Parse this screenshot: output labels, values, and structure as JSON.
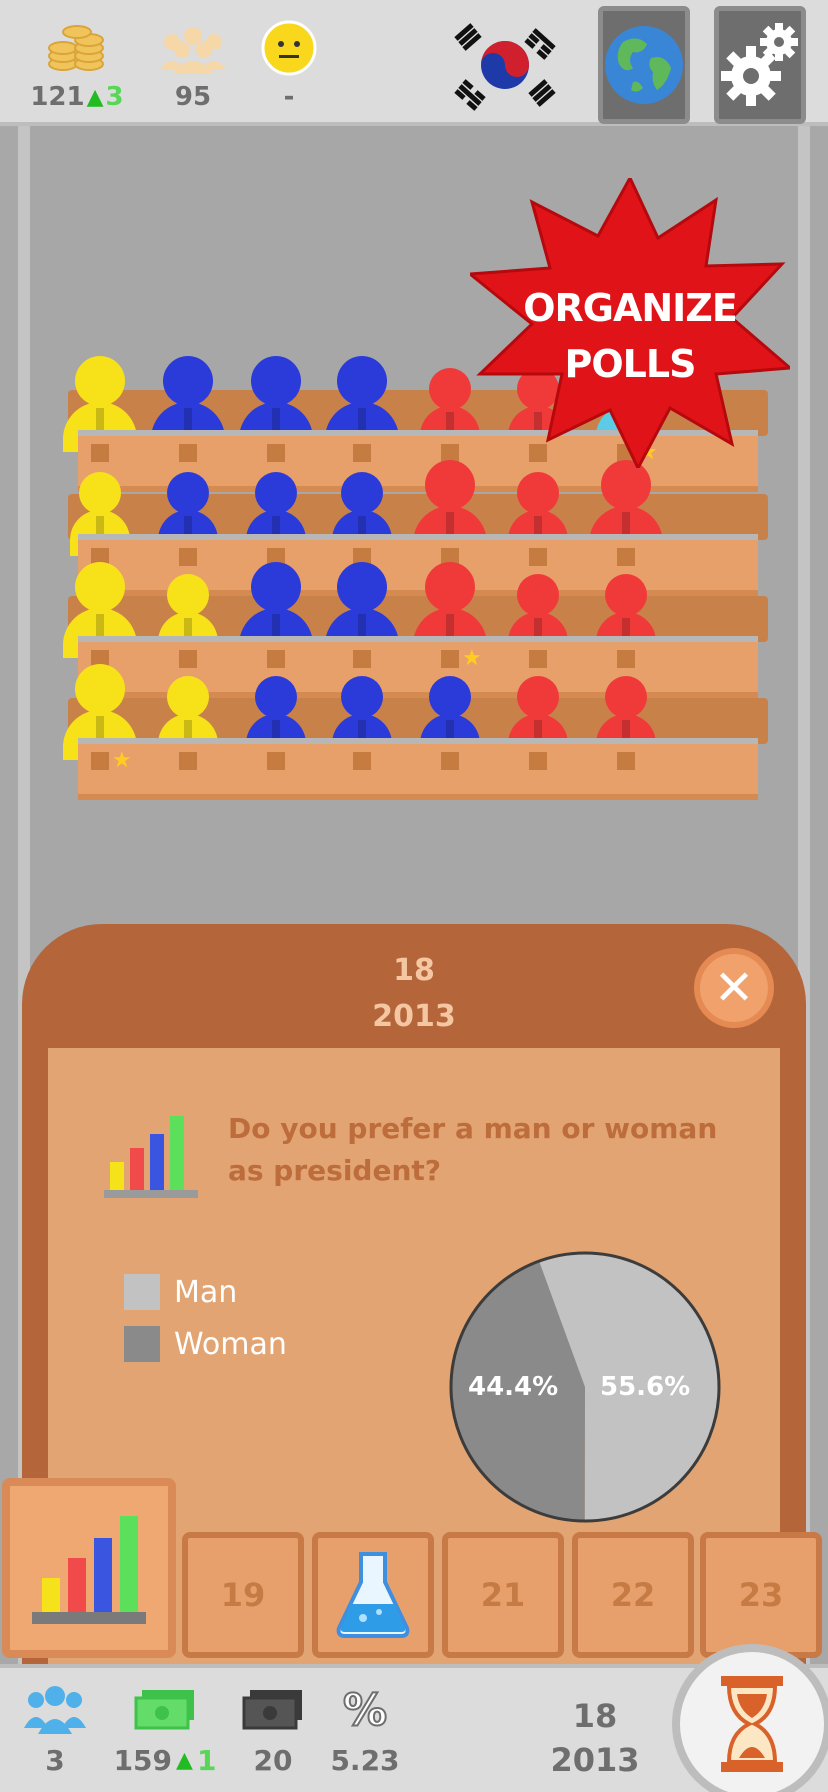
{
  "topbar": {
    "coins": {
      "value": "121",
      "increase": "3",
      "icon": "coins-icon"
    },
    "population": {
      "value": "95",
      "icon": "crowd-icon"
    },
    "mood": {
      "value": "-",
      "icon": "neutral-face-icon"
    },
    "flag": "south-korea-flag-icon",
    "globe_icon": "globe-icon",
    "settings_icon": "gear-icon"
  },
  "banner": {
    "line1": "ORGANIZE",
    "line2": "POLLS"
  },
  "colors": {
    "yellow": "#f7e21a",
    "blue": "#2b3bd9",
    "red": "#f03a3a",
    "cyan": "#5ccbe6"
  },
  "parliament": {
    "rows": [
      [
        "yellow",
        "blue",
        "blue",
        "blue",
        "red",
        "red",
        "cyan"
      ],
      [
        "yellow",
        "blue",
        "blue",
        "blue",
        "red",
        "red",
        "red"
      ],
      [
        "yellow",
        "yellow",
        "blue",
        "blue",
        "red",
        "red",
        "red"
      ],
      [
        "yellow",
        "yellow",
        "blue",
        "blue",
        "blue",
        "red",
        "red"
      ]
    ]
  },
  "poll": {
    "date_day": "18",
    "date_year": "2013",
    "question": "Do you prefer a man or woman as president?",
    "legend": [
      {
        "label": "Man",
        "color": "#c2c2c2"
      },
      {
        "label": "Woman",
        "color": "#8a8a8a"
      }
    ],
    "results": [
      {
        "label": "Man",
        "value": 55.6,
        "text": "55.6%"
      },
      {
        "label": "Woman",
        "value": 44.4,
        "text": "44.4%"
      }
    ]
  },
  "tabs": [
    "19",
    "21",
    "22",
    "23"
  ],
  "bottombar": {
    "people": {
      "value": "3",
      "icon": "people-icon"
    },
    "money": {
      "value": "159",
      "increase": "1",
      "icon": "banknote-icon"
    },
    "debt": {
      "value": "20",
      "icon": "dark-banknote-icon"
    },
    "rate": {
      "symbol": "%",
      "value": "5.23"
    },
    "date_day": "18",
    "date_year": "2013",
    "hourglass_icon": "hourglass-icon"
  }
}
